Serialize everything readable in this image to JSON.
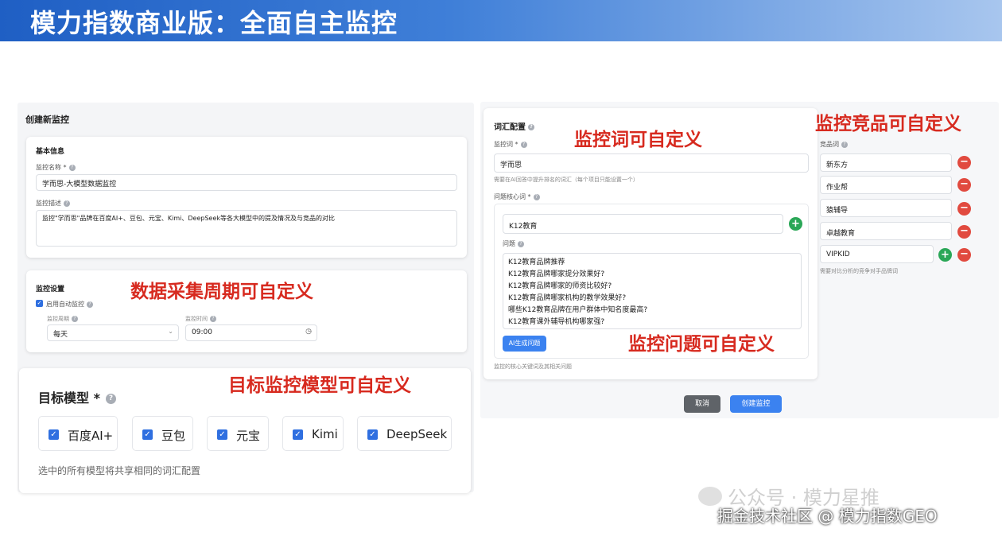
{
  "banner": {
    "title": "模力指数商业版：全面自主监控"
  },
  "form": {
    "title": "创建新监控",
    "basic": {
      "heading": "基本信息",
      "name_label": "监控名称 *",
      "name_value": "学而思-大模型数据监控",
      "desc_label": "监控描述",
      "desc_value": "监控\"学而思\"品牌在百度AI+、豆包、元宝、Kimi、DeepSeek等各大模型中的提及情况及与竞品的对比"
    },
    "settings": {
      "heading": "监控设置",
      "auto_label": "启用自动监控",
      "period_label": "监控周期",
      "period_value": "每天",
      "time_label": "监控时间",
      "time_value": "09:00"
    },
    "models": {
      "heading": "目标模型 *",
      "items": [
        "百度AI+",
        "豆包",
        "元宝",
        "Kimi",
        "DeepSeek"
      ],
      "note": "选中的所有模型将共享相同的词汇配置"
    }
  },
  "vocab": {
    "heading": "词汇配置",
    "keyword_label": "监控词 *",
    "keyword_value": "学而思",
    "keyword_hint": "需要在AI回答中提升排名的词汇（每个项目只能设置一个）",
    "core_label": "问题核心词 *",
    "core_value": "K12教育",
    "question_label": "问题",
    "questions": [
      "K12教育品牌推荐",
      "K12教育品牌哪家提分效果好?",
      "K12教育品牌哪家的师资比较好?",
      "K12教育品牌哪家机构的教学效果好?",
      "哪些K12教育品牌在用户群体中知名度最高?",
      "K12教育课外辅导机构哪家强?"
    ],
    "ai_button": "AI生成问题",
    "core_hint": "监控的核心关键词及其相关问题",
    "competitor_label": "竞品词",
    "competitors": [
      "新东方",
      "作业帮",
      "猿辅导",
      "卓越教育",
      "VIPKID"
    ],
    "competitor_hint": "需要对比分析的竞争对手品牌词"
  },
  "actions": {
    "cancel": "取消",
    "create": "创建监控"
  },
  "annotations": {
    "keyword": "监控词可自定义",
    "competitor": "监控竞品可自定义",
    "period": "数据采集周期可自定义",
    "question": "监控问题可自定义",
    "model": "目标监控模型可自定义"
  },
  "watermark": {
    "line1": "公众号 · 模力星推",
    "line2": "掘金技术社区 @ 模力指数GEO"
  },
  "colors": {
    "accent": "#2f6fe0",
    "annotation": "#d72a1f",
    "add": "#2aa757",
    "remove": "#e14a3f",
    "cancel": "#5f6368"
  }
}
